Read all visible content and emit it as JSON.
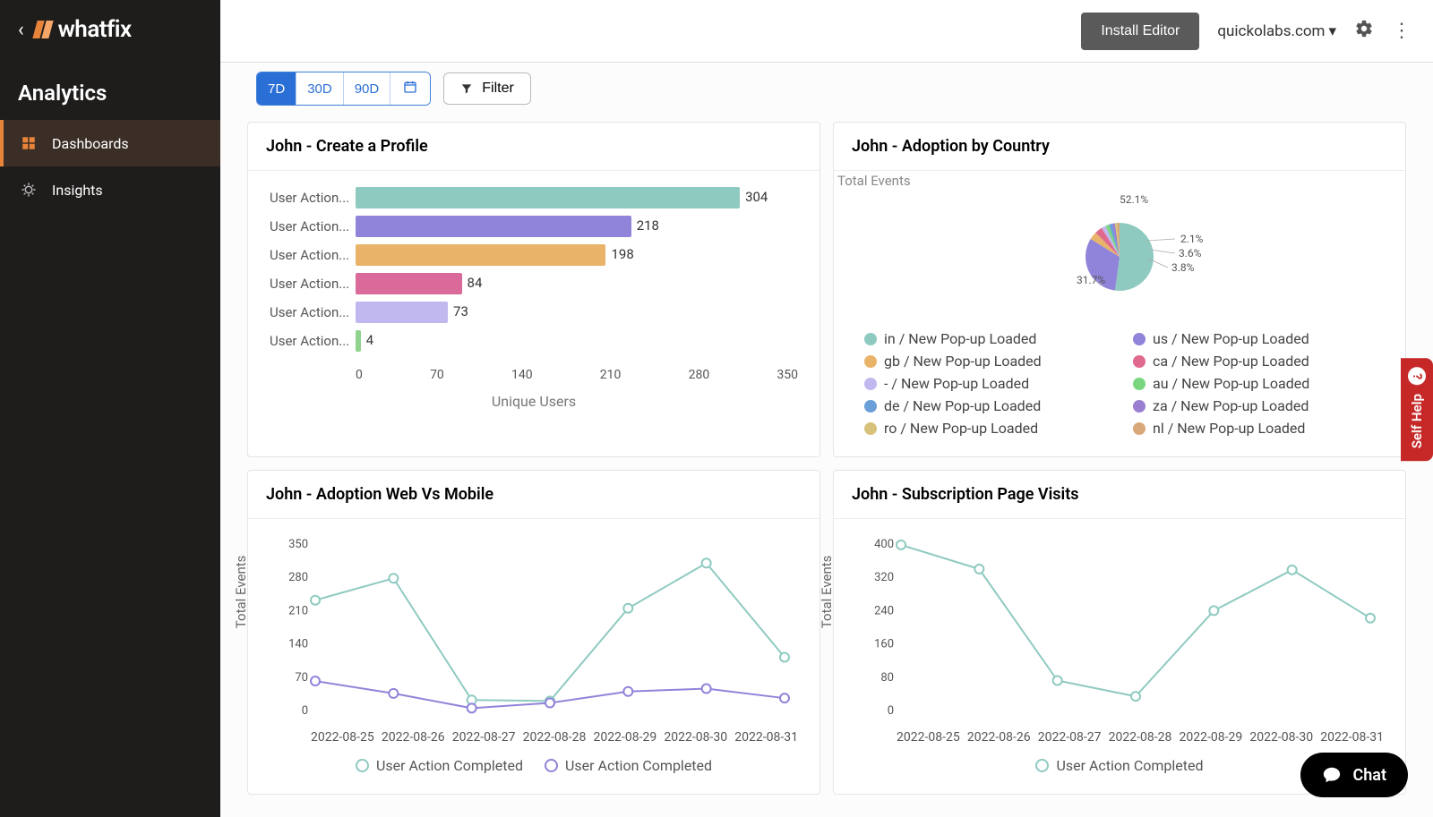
{
  "brand": "whatfix",
  "section": "Analytics",
  "nav": [
    {
      "label": "Dashboards",
      "active": true
    },
    {
      "label": "Insights",
      "active": false
    }
  ],
  "topbar": {
    "install": "Install Editor",
    "account": "quickolabs.com"
  },
  "toolbar": {
    "ranges": [
      "7D",
      "30D",
      "90D"
    ],
    "active_range": "7D",
    "filter": "Filter"
  },
  "self_help": "Self Help",
  "chat": "Chat",
  "cards": {
    "profile": {
      "title": "John - Create a Profile"
    },
    "country": {
      "title": "John - Adoption by Country",
      "subtitle": "Total Events"
    },
    "webmobile": {
      "title": "John - Adoption Web Vs Mobile"
    },
    "subscription": {
      "title": "John - Subscription Page Visits"
    }
  },
  "chart_data": [
    {
      "id": "profile",
      "type": "bar",
      "orientation": "horizontal",
      "xlabel": "Unique Users",
      "xlim": [
        0,
        350
      ],
      "xticks": [
        0,
        70,
        140,
        210,
        280,
        350
      ],
      "categories": [
        "User Action...",
        "User Action...",
        "User Action...",
        "User Action...",
        "User Action...",
        "User Action..."
      ],
      "values": [
        304,
        218,
        198,
        84,
        73,
        4
      ],
      "colors": [
        "#8fcac1",
        "#8f84d9",
        "#e9b46a",
        "#d96a9a",
        "#c0b8ef",
        "#8fd38f"
      ]
    },
    {
      "id": "country",
      "type": "pie",
      "series": [
        {
          "name": "in / New Pop-up Loaded",
          "value": 52.1,
          "color": "#8fcac1"
        },
        {
          "name": "us / New Pop-up Loaded",
          "value": 31.7,
          "color": "#8f84d9"
        },
        {
          "name": "gb / New Pop-up Loaded",
          "value": 3.8,
          "color": "#e9b46a"
        },
        {
          "name": "ca / New Pop-up Loaded",
          "value": 3.6,
          "color": "#e06a8e"
        },
        {
          "name": "- / New Pop-up Loaded",
          "value": 2.1,
          "color": "#c0b8ef"
        },
        {
          "name": "au / New Pop-up Loaded",
          "value": 1.7,
          "color": "#79d67f"
        },
        {
          "name": "de / New Pop-up Loaded",
          "value": 1.5,
          "color": "#6a9fd9"
        },
        {
          "name": "za / New Pop-up Loaded",
          "value": 1.3,
          "color": "#9a7fd1"
        },
        {
          "name": "ro / New Pop-up Loaded",
          "value": 1.1,
          "color": "#d8c17a"
        },
        {
          "name": "nl / New Pop-up Loaded",
          "value": 1.1,
          "color": "#d8a87a"
        }
      ],
      "labels_shown": [
        "52.1%",
        "31.7%",
        "3.8%",
        "3.6%",
        "2.1%"
      ]
    },
    {
      "id": "webmobile",
      "type": "line",
      "ylabel": "Total Events",
      "ylim": [
        0,
        350
      ],
      "yticks": [
        0,
        70,
        140,
        210,
        280,
        350
      ],
      "x": [
        "2022-08-25",
        "2022-08-26",
        "2022-08-27",
        "2022-08-28",
        "2022-08-29",
        "2022-08-30",
        "2022-08-31"
      ],
      "series": [
        {
          "name": "User Action Completed",
          "color": "#8fcac1",
          "values": [
            232,
            278,
            22,
            20,
            215,
            310,
            112
          ]
        },
        {
          "name": "User Action Completed",
          "color": "#8f84d9",
          "values": [
            62,
            36,
            5,
            16,
            40,
            46,
            26
          ]
        }
      ]
    },
    {
      "id": "subscription",
      "type": "line",
      "ylabel": "Total Events",
      "ylim": [
        0,
        400
      ],
      "yticks": [
        0,
        80,
        160,
        240,
        320,
        400
      ],
      "x": [
        "2022-08-25",
        "2022-08-26",
        "2022-08-27",
        "2022-08-28",
        "2022-08-29",
        "2022-08-30",
        "2022-08-31"
      ],
      "series": [
        {
          "name": "User Action Completed",
          "color": "#8fcac1",
          "values": [
            398,
            340,
            72,
            34,
            240,
            338,
            222
          ]
        }
      ]
    }
  ]
}
